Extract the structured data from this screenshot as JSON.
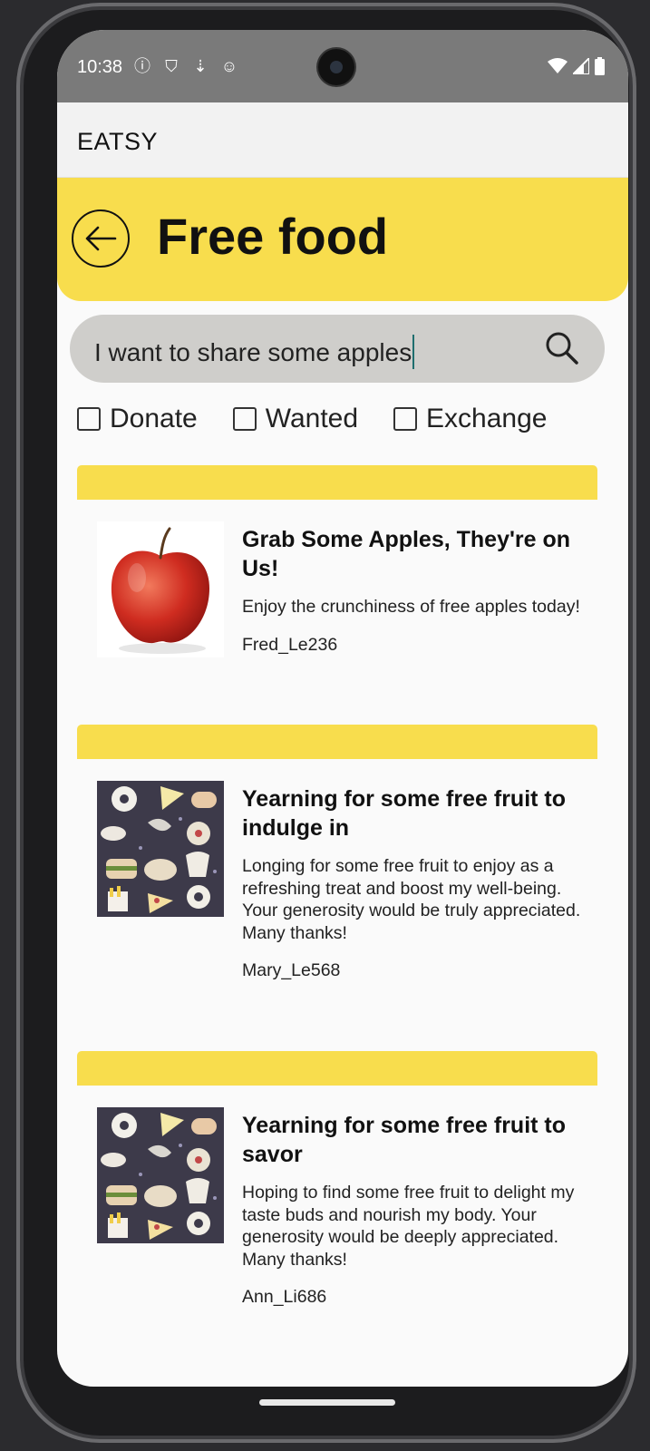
{
  "status_bar": {
    "time": "10:38",
    "left_icons": [
      "info-icon",
      "shield-icon",
      "download-icon",
      "face-icon"
    ],
    "right_icons": [
      "wifi-icon",
      "signal-icon",
      "battery-icon"
    ]
  },
  "app_bar": {
    "title": "EATSY"
  },
  "header": {
    "title": "Free food"
  },
  "search": {
    "value": "I want to share some apples"
  },
  "filters": [
    {
      "label": "Donate",
      "checked": false
    },
    {
      "label": "Wanted",
      "checked": false
    },
    {
      "label": "Exchange",
      "checked": false
    }
  ],
  "posts": [
    {
      "title": "Grab Some Apples, They're on Us!",
      "description": "Enjoy the crunchiness of free apples today!",
      "user": "Fred_Le236",
      "image": "apple"
    },
    {
      "title": "Yearning for some free fruit to indulge in",
      "description": "Longing for some free fruit to enjoy as a refreshing treat and boost my well-being. Your generosity would be truly appreciated. Many thanks!",
      "user": "Mary_Le568",
      "image": "food-pattern"
    },
    {
      "title": "Yearning for some free fruit to savor",
      "description": "Hoping to find some free fruit to delight my taste buds and nourish my body. Your generosity would be deeply appreciated. Many thanks!",
      "user": "Ann_Li686",
      "image": "food-pattern"
    }
  ],
  "colors": {
    "accent": "#f8dd4d",
    "search_bg": "#cfcecb",
    "status_bar": "#7a7a7a"
  }
}
